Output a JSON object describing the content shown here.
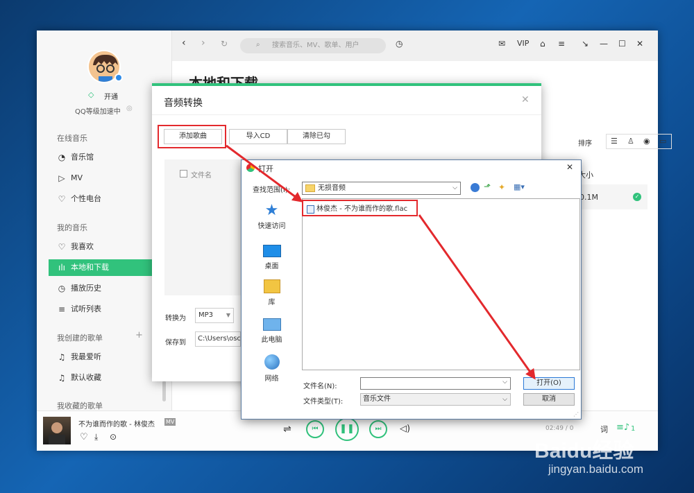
{
  "sidebar": {
    "vip_label": "开通",
    "qq_level": "QQ等级加速中",
    "sections": {
      "online": "在线音乐",
      "mine": "我的音乐",
      "created": "我创建的歌单",
      "collected": "我收藏的歌单"
    },
    "online_items": [
      "音乐馆",
      "MV",
      "个性电台"
    ],
    "mine_items": [
      "我喜欢",
      "本地和下载",
      "播放历史",
      "试听列表"
    ],
    "created_items": [
      "我最爱听",
      "默认收藏"
    ]
  },
  "topbar": {
    "search_placeholder": "搜索音乐、MV、歌单、用户",
    "vip": "VIP"
  },
  "page": {
    "title": "本地和下载",
    "sort_label": "排序",
    "col_size": "大小",
    "row_size": "30.1M"
  },
  "convert_dialog": {
    "title": "音频转换",
    "add_song": "添加歌曲",
    "import_cd": "导入CD",
    "clear_checked": "清除已勾",
    "col_filename": "文件名",
    "convert_to_label": "转换为",
    "convert_format": "MP3",
    "save_to_label": "保存到",
    "save_path": "C:\\Users\\osc"
  },
  "open_dialog": {
    "title": "打开",
    "lookin_label": "查找范围(I):",
    "lookin_value": "无损音频",
    "file_item": "林俊杰 - 不为谁而作的歌.flac",
    "places": [
      "快速访问",
      "桌面",
      "库",
      "此电脑",
      "网络"
    ],
    "filename_label": "文件名(N):",
    "filetype_label": "文件类型(T):",
    "filetype_value": "音乐文件",
    "open_button": "打开(O)",
    "cancel_button": "取消"
  },
  "player": {
    "song": "不为谁而作的歌 - 林俊杰",
    "mv_badge": "MV",
    "time": "02:49 / 0",
    "playlist_count": "1"
  },
  "watermark": {
    "brand": "Baidu经验",
    "url": "jingyan.baidu.com"
  },
  "colors": {
    "accent_green": "#31c27c",
    "highlight_red": "#e3292d"
  }
}
